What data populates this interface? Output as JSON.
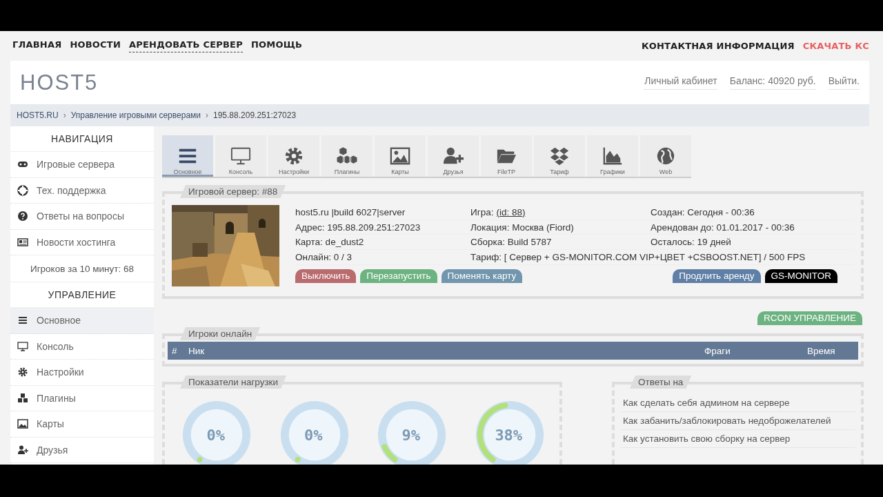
{
  "top_nav": {
    "left": [
      {
        "label": "ГЛАВНАЯ",
        "kind": "plain"
      },
      {
        "label": "НОВОСТИ",
        "kind": "plain"
      },
      {
        "label": "АРЕНДОВАТЬ СЕРВЕР",
        "kind": "dotted"
      },
      {
        "label": "ПОМОЩЬ",
        "kind": "plain"
      }
    ],
    "right": [
      {
        "label": "КОНТАКТНАЯ ИНФОРМАЦИЯ",
        "kind": "plain"
      },
      {
        "label": "СКАЧАТЬ КС",
        "kind": "accent"
      }
    ]
  },
  "header": {
    "logo": "HOST5",
    "links": [
      "Личный кабинет",
      "Баланс: 40920 руб.",
      "Выйти."
    ]
  },
  "breadcrumb": [
    {
      "label": "HOST5.RU",
      "kind": "link"
    },
    {
      "label": "›",
      "kind": "separator"
    },
    {
      "label": "Управление игровыми серверами",
      "kind": "link"
    },
    {
      "label": "›",
      "kind": "separator"
    },
    {
      "label": "195.88.209.251:27023",
      "kind": "current"
    }
  ],
  "sidebar": {
    "sections": [
      {
        "title": "НАВИГАЦИЯ",
        "items": [
          {
            "label": "Игровые сервера",
            "selected": false
          },
          {
            "label": "Тех. поддержка",
            "selected": false
          },
          {
            "label": "Ответы на вопросы",
            "selected": false
          },
          {
            "label": "Новости хостинга",
            "selected": false
          }
        ],
        "stat": "Игроков за 10 минут: 68"
      },
      {
        "title": "УПРАВЛЕНИЕ",
        "items": [
          {
            "label": "Основное",
            "selected": true
          },
          {
            "label": "Консоль",
            "selected": false
          },
          {
            "label": "Настройки",
            "selected": false
          },
          {
            "label": "Плагины",
            "selected": false
          },
          {
            "label": "Карты",
            "selected": false
          },
          {
            "label": "Друзья",
            "selected": false
          }
        ]
      }
    ]
  },
  "toolbar": [
    {
      "label": "Основное",
      "selected": true
    },
    {
      "label": "Консоль",
      "selected": false
    },
    {
      "label": "Настройки",
      "selected": false
    },
    {
      "label": "Плагины",
      "selected": false
    },
    {
      "label": "Карты",
      "selected": false
    },
    {
      "label": "Друзья",
      "selected": false
    },
    {
      "label": "FileTP",
      "selected": false
    },
    {
      "label": "Тариф",
      "selected": false
    },
    {
      "label": "Графики",
      "selected": false
    },
    {
      "label": "Web",
      "selected": false
    }
  ],
  "server": {
    "title": "Игровой сервер: #88",
    "info": [
      "host5.ru |build 6027|server",
      "Адрес: 195.88.209.251:27023",
      "Карта: de_dust2",
      "Онлайн: 0 / 3"
    ],
    "details": [
      {
        "label": "Игра:",
        "link": "(id: 88)"
      },
      {
        "label": "Локация: Москва (Fiord)"
      },
      {
        "label": "Сборка: Build 5787"
      }
    ],
    "dates": [
      "Создан: Сегодня - 00:36",
      "Арендован до: 01.01.2017 - 00:36",
      "Осталось: 19 дней"
    ],
    "tariff": "Тариф: [ Сервер + GS-MONITOR.COM VIP+ЦВЕТ +CSBOOST.NET] / 500 FPS",
    "buttons": [
      {
        "label": "Выключить",
        "color": "#b96b6e"
      },
      {
        "label": "Перезапустить",
        "color": "#6db381"
      },
      {
        "label": "Поменять карту",
        "color": "#7196ad"
      }
    ],
    "right_buttons": [
      {
        "label": "Продлить аренду",
        "color": "#5f7fa6"
      },
      {
        "label": "GS-MONITOR",
        "color": "#000000"
      }
    ]
  },
  "rcon_button": "RCON УПРАВЛЕНИЕ",
  "players": {
    "title": "Игроки онлайн",
    "columns": [
      "#",
      "Ник",
      "Фраги",
      "Время"
    ]
  },
  "load": {
    "title": "Показатели нагрузки",
    "gauges": [
      {
        "value": "0%"
      },
      {
        "value": "0%"
      },
      {
        "value": "9%"
      },
      {
        "value": "38%"
      }
    ]
  },
  "answers": {
    "title": "Ответы на",
    "items": [
      "Как сделать себя админом на сервере",
      "Как забанить/заблокировать недоброжелателей",
      "Как установить свою сборку на сервер"
    ]
  }
}
